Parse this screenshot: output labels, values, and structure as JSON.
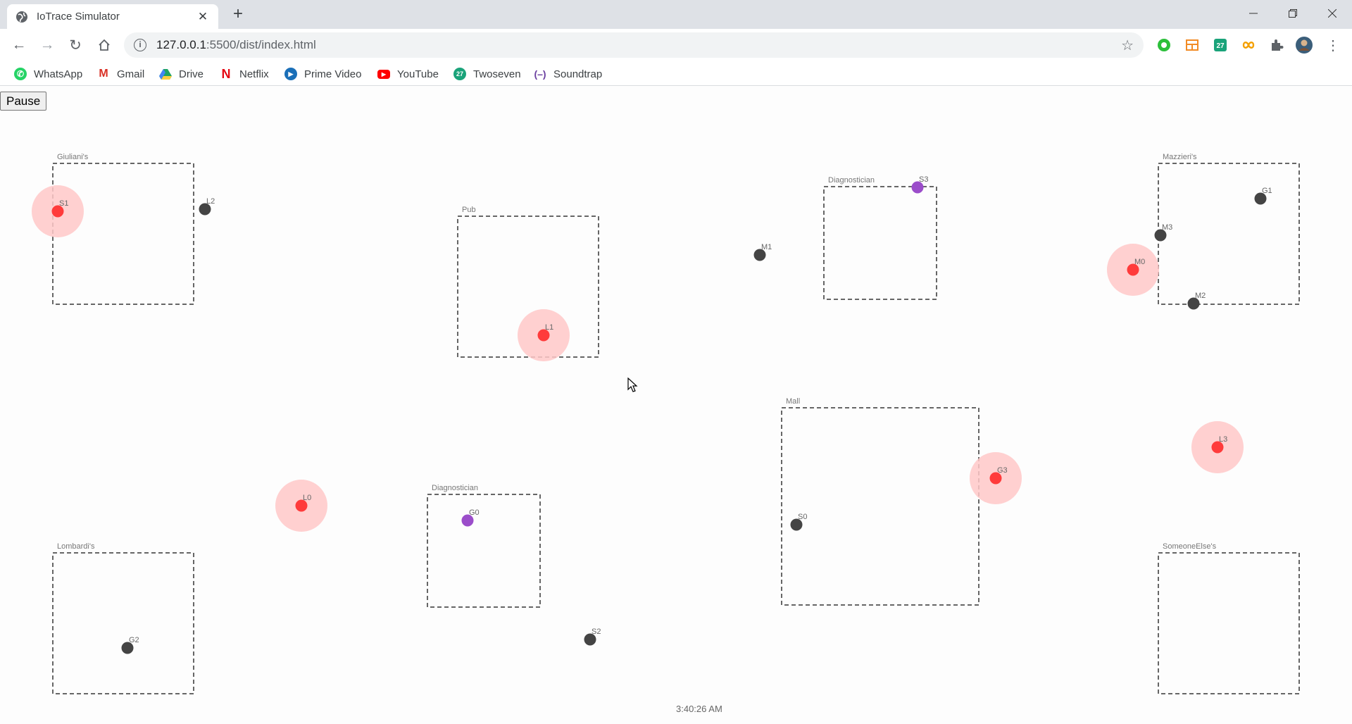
{
  "browser": {
    "tab_title": "IoTrace Simulator",
    "url_host": "127.0.0.1",
    "url_rest": ":5500/dist/index.html",
    "bookmarks": [
      {
        "label": "WhatsApp",
        "icon": "whatsapp-icon",
        "color": "#25d366"
      },
      {
        "label": "Gmail",
        "icon": "gmail-icon",
        "color": "#d93025"
      },
      {
        "label": "Drive",
        "icon": "drive-icon",
        "color": "#1fa463"
      },
      {
        "label": "Netflix",
        "icon": "netflix-icon",
        "color": "#e50914"
      },
      {
        "label": "Prime Video",
        "icon": "prime-video-icon",
        "color": "#1a98ff"
      },
      {
        "label": "YouTube",
        "icon": "youtube-icon",
        "color": "#ff0000"
      },
      {
        "label": "Twoseven",
        "icon": "twoseven-icon",
        "color": "#1aa37a"
      },
      {
        "label": "Soundtrap",
        "icon": "soundtrap-icon",
        "color": "#6b3fa0"
      }
    ]
  },
  "page": {
    "pause_label": "Pause",
    "clock": "3:40:26 AM"
  },
  "colors": {
    "infected": "#ff3b3b",
    "infected_halo": "#ffc8c8",
    "healthy": "#444444",
    "diagnosed": "#9b4dca",
    "zone_border": "#666666"
  },
  "zones": [
    {
      "name": "Giuliani's"
    },
    {
      "name": "Pub"
    },
    {
      "name": "Diagnostician"
    },
    {
      "name": "Mazzieri's"
    },
    {
      "name": "Mall"
    },
    {
      "name": "Diagnostician"
    },
    {
      "name": "Lombardi's"
    },
    {
      "name": "SomeoneElse's"
    }
  ],
  "devices": [
    {
      "id": "S1",
      "state": "infected"
    },
    {
      "id": "L2",
      "state": "healthy"
    },
    {
      "id": "L1",
      "state": "infected"
    },
    {
      "id": "M1",
      "state": "healthy"
    },
    {
      "id": "S3",
      "state": "diagnosed"
    },
    {
      "id": "G1",
      "state": "healthy"
    },
    {
      "id": "M3",
      "state": "healthy"
    },
    {
      "id": "M0",
      "state": "infected"
    },
    {
      "id": "M2",
      "state": "healthy"
    },
    {
      "id": "L3",
      "state": "infected"
    },
    {
      "id": "G3",
      "state": "infected"
    },
    {
      "id": "S0",
      "state": "healthy"
    },
    {
      "id": "L0",
      "state": "infected"
    },
    {
      "id": "G0",
      "state": "diagnosed"
    },
    {
      "id": "G2",
      "state": "healthy"
    },
    {
      "id": "S2",
      "state": "healthy"
    }
  ]
}
